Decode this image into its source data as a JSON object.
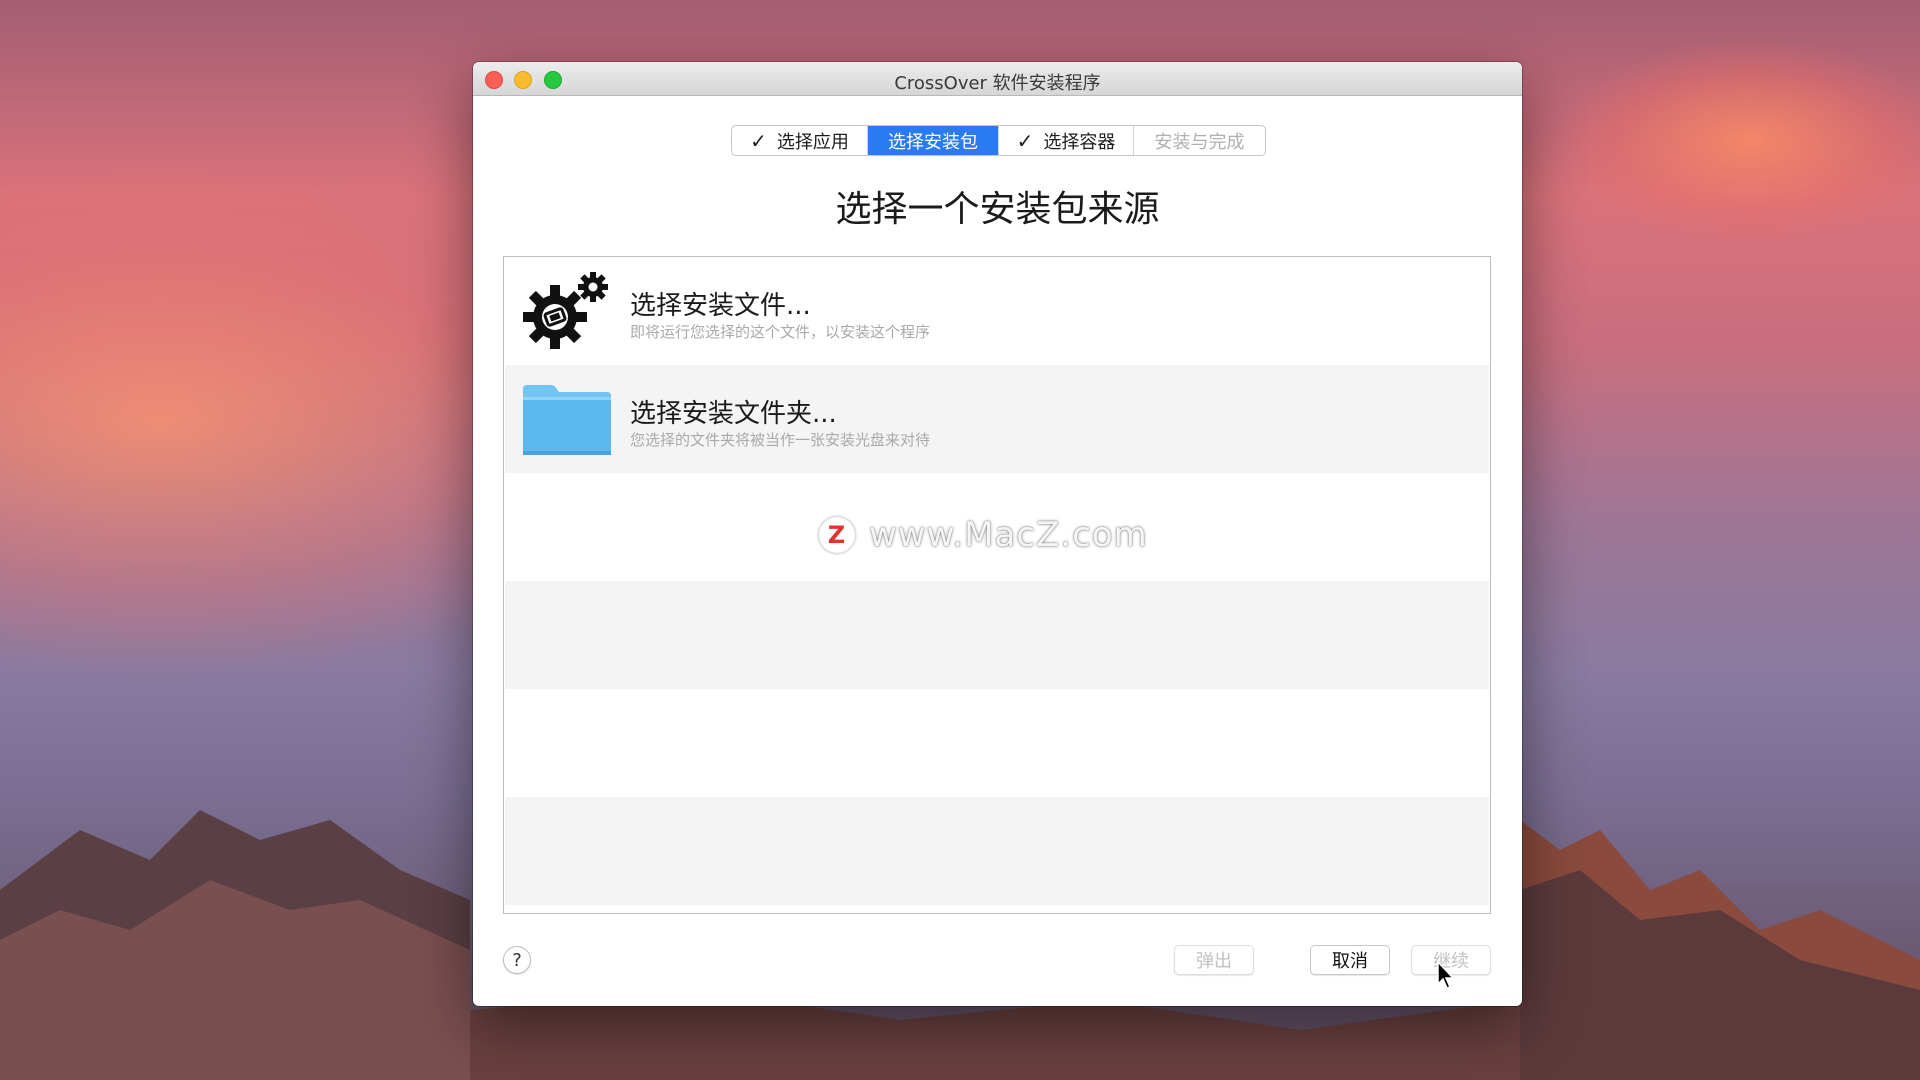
{
  "window": {
    "title": "CrossOver 软件安装程序"
  },
  "steps": [
    {
      "label": "选择应用",
      "checked": true,
      "state": "done"
    },
    {
      "label": "选择安装包",
      "checked": false,
      "state": "active"
    },
    {
      "label": "选择容器",
      "checked": true,
      "state": "done"
    },
    {
      "label": "安装与完成",
      "checked": false,
      "state": "disabled"
    }
  ],
  "check_glyph": "✓",
  "heading": "选择一个安装包来源",
  "sources": [
    {
      "title": "选择安装文件...",
      "description": "即将运行您选择的这个文件，以安装这个程序",
      "icon": "gears-icon"
    },
    {
      "title": "选择安装文件夹...",
      "description": "您选择的文件夹将被当作一张安装光盘来对待",
      "icon": "folder-icon"
    }
  ],
  "watermark": {
    "logo": "Z",
    "text": "www.MacZ.com"
  },
  "footer": {
    "help_label": "?",
    "eject_label": "弹出",
    "cancel_label": "取消",
    "continue_label": "继续"
  },
  "colors": {
    "accent": "#2a7af2",
    "folder": "#5cb8ee",
    "close": "#fc5f57",
    "minimize": "#fdbc2e",
    "maximize": "#28c840"
  }
}
